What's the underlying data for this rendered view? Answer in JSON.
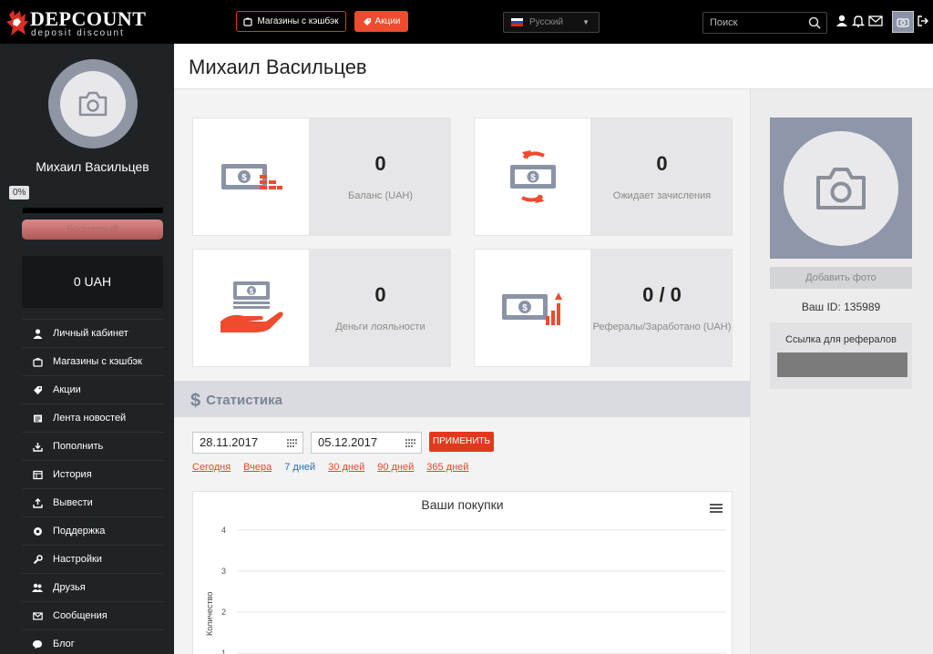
{
  "header": {
    "logo_title": "DEPCOUNT",
    "logo_subtitle": "deposit discount",
    "shops_button": "Магазины с кэшбэк",
    "promo_button": "Акции",
    "language": "Русский",
    "search_placeholder": "Поиск"
  },
  "sidebar": {
    "user_name": "Михаил Васильцев",
    "progress_label": "0%",
    "progress_percent": 0,
    "rank": "Бронзовый",
    "balance": "0 UAH",
    "menu": [
      {
        "label": "Личный кабинет",
        "icon": "user-icon"
      },
      {
        "label": "Магазины с кэшбэк",
        "icon": "shop-icon"
      },
      {
        "label": "Акции",
        "icon": "tag-icon"
      },
      {
        "label": "Лента новостей",
        "icon": "newspaper-icon"
      },
      {
        "label": "Пополнить",
        "icon": "download-icon"
      },
      {
        "label": "История",
        "icon": "history-icon"
      },
      {
        "label": "Вывести",
        "icon": "upload-icon"
      },
      {
        "label": "Поддержка",
        "icon": "support-icon"
      },
      {
        "label": "Настройки",
        "icon": "wrench-icon"
      },
      {
        "label": "Друзья",
        "icon": "friends-icon"
      },
      {
        "label": "Сообщения",
        "icon": "envelope-icon"
      },
      {
        "label": "Блог",
        "icon": "blog-icon"
      }
    ]
  },
  "page": {
    "title": "Михаил Васильцев"
  },
  "cards": [
    {
      "value": "0",
      "label": "Баланс (UAH)"
    },
    {
      "value": "0",
      "label": "Ожидает зачисления"
    },
    {
      "value": "0",
      "label": "Деньги лояльности"
    },
    {
      "value": "0 / 0",
      "label": "Рефералы/Заработано (UAH)"
    }
  ],
  "statistics": {
    "title": "Статистика",
    "date_from": "28.11.2017",
    "date_to": "05.12.2017",
    "apply_button": "ПРИМЕНИТЬ",
    "ranges": [
      "Сегодня",
      "Вчера",
      "7 дней",
      "30 дней",
      "90 дней",
      "365 дней"
    ],
    "active_range": "7 дней"
  },
  "chart_data": {
    "type": "line",
    "title": "Ваши покупки",
    "ylabel": "Количество",
    "xlabel": "",
    "y_ticks": [
      "4",
      "3",
      "2",
      "1"
    ],
    "ylim": [
      1,
      4
    ],
    "grid": true,
    "series": []
  },
  "right_panel": {
    "add_photo": "Добавить фото",
    "user_id": "Ваш ID: 135989",
    "referral_title": "Ссылка для рефералов"
  },
  "colors": {
    "accent": "#ee4b2f",
    "sidebar_bg": "#1f2326",
    "card_icon": "#8a93a6"
  }
}
